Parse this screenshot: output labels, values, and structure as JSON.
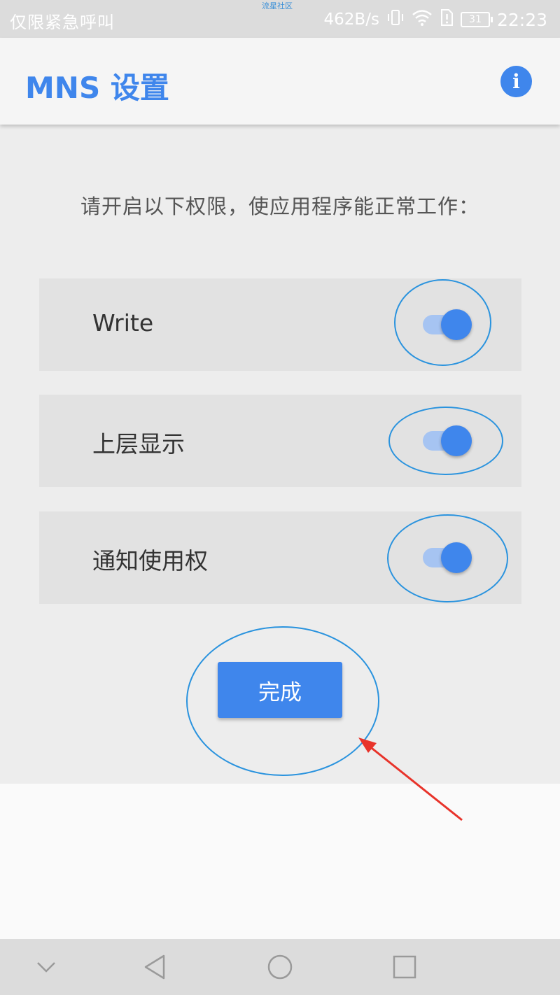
{
  "status_bar": {
    "carrier": "仅限紧急呼叫",
    "watermark": "流星社区",
    "speed": "462B/s",
    "battery": "31",
    "time": "22:23",
    "icons": [
      "vibrate-icon",
      "wifi-icon",
      "sim-alert-icon",
      "battery-icon"
    ]
  },
  "app_bar": {
    "title": "MNS 设置",
    "info_icon": "i"
  },
  "main": {
    "prompt": "请开启以下权限，使应用程序能正常工作：",
    "permissions": [
      {
        "label": "Write",
        "enabled": true
      },
      {
        "label": "上层显示",
        "enabled": true
      },
      {
        "label": "通知使用权",
        "enabled": true
      }
    ],
    "done_label": "完成"
  },
  "colors": {
    "accent": "#3f86ec",
    "annotation": "#2a93de",
    "arrow": "#e8332a"
  },
  "nav_bar": {
    "icons": [
      "chevron-down-icon",
      "back-icon",
      "home-icon",
      "recents-icon"
    ]
  }
}
